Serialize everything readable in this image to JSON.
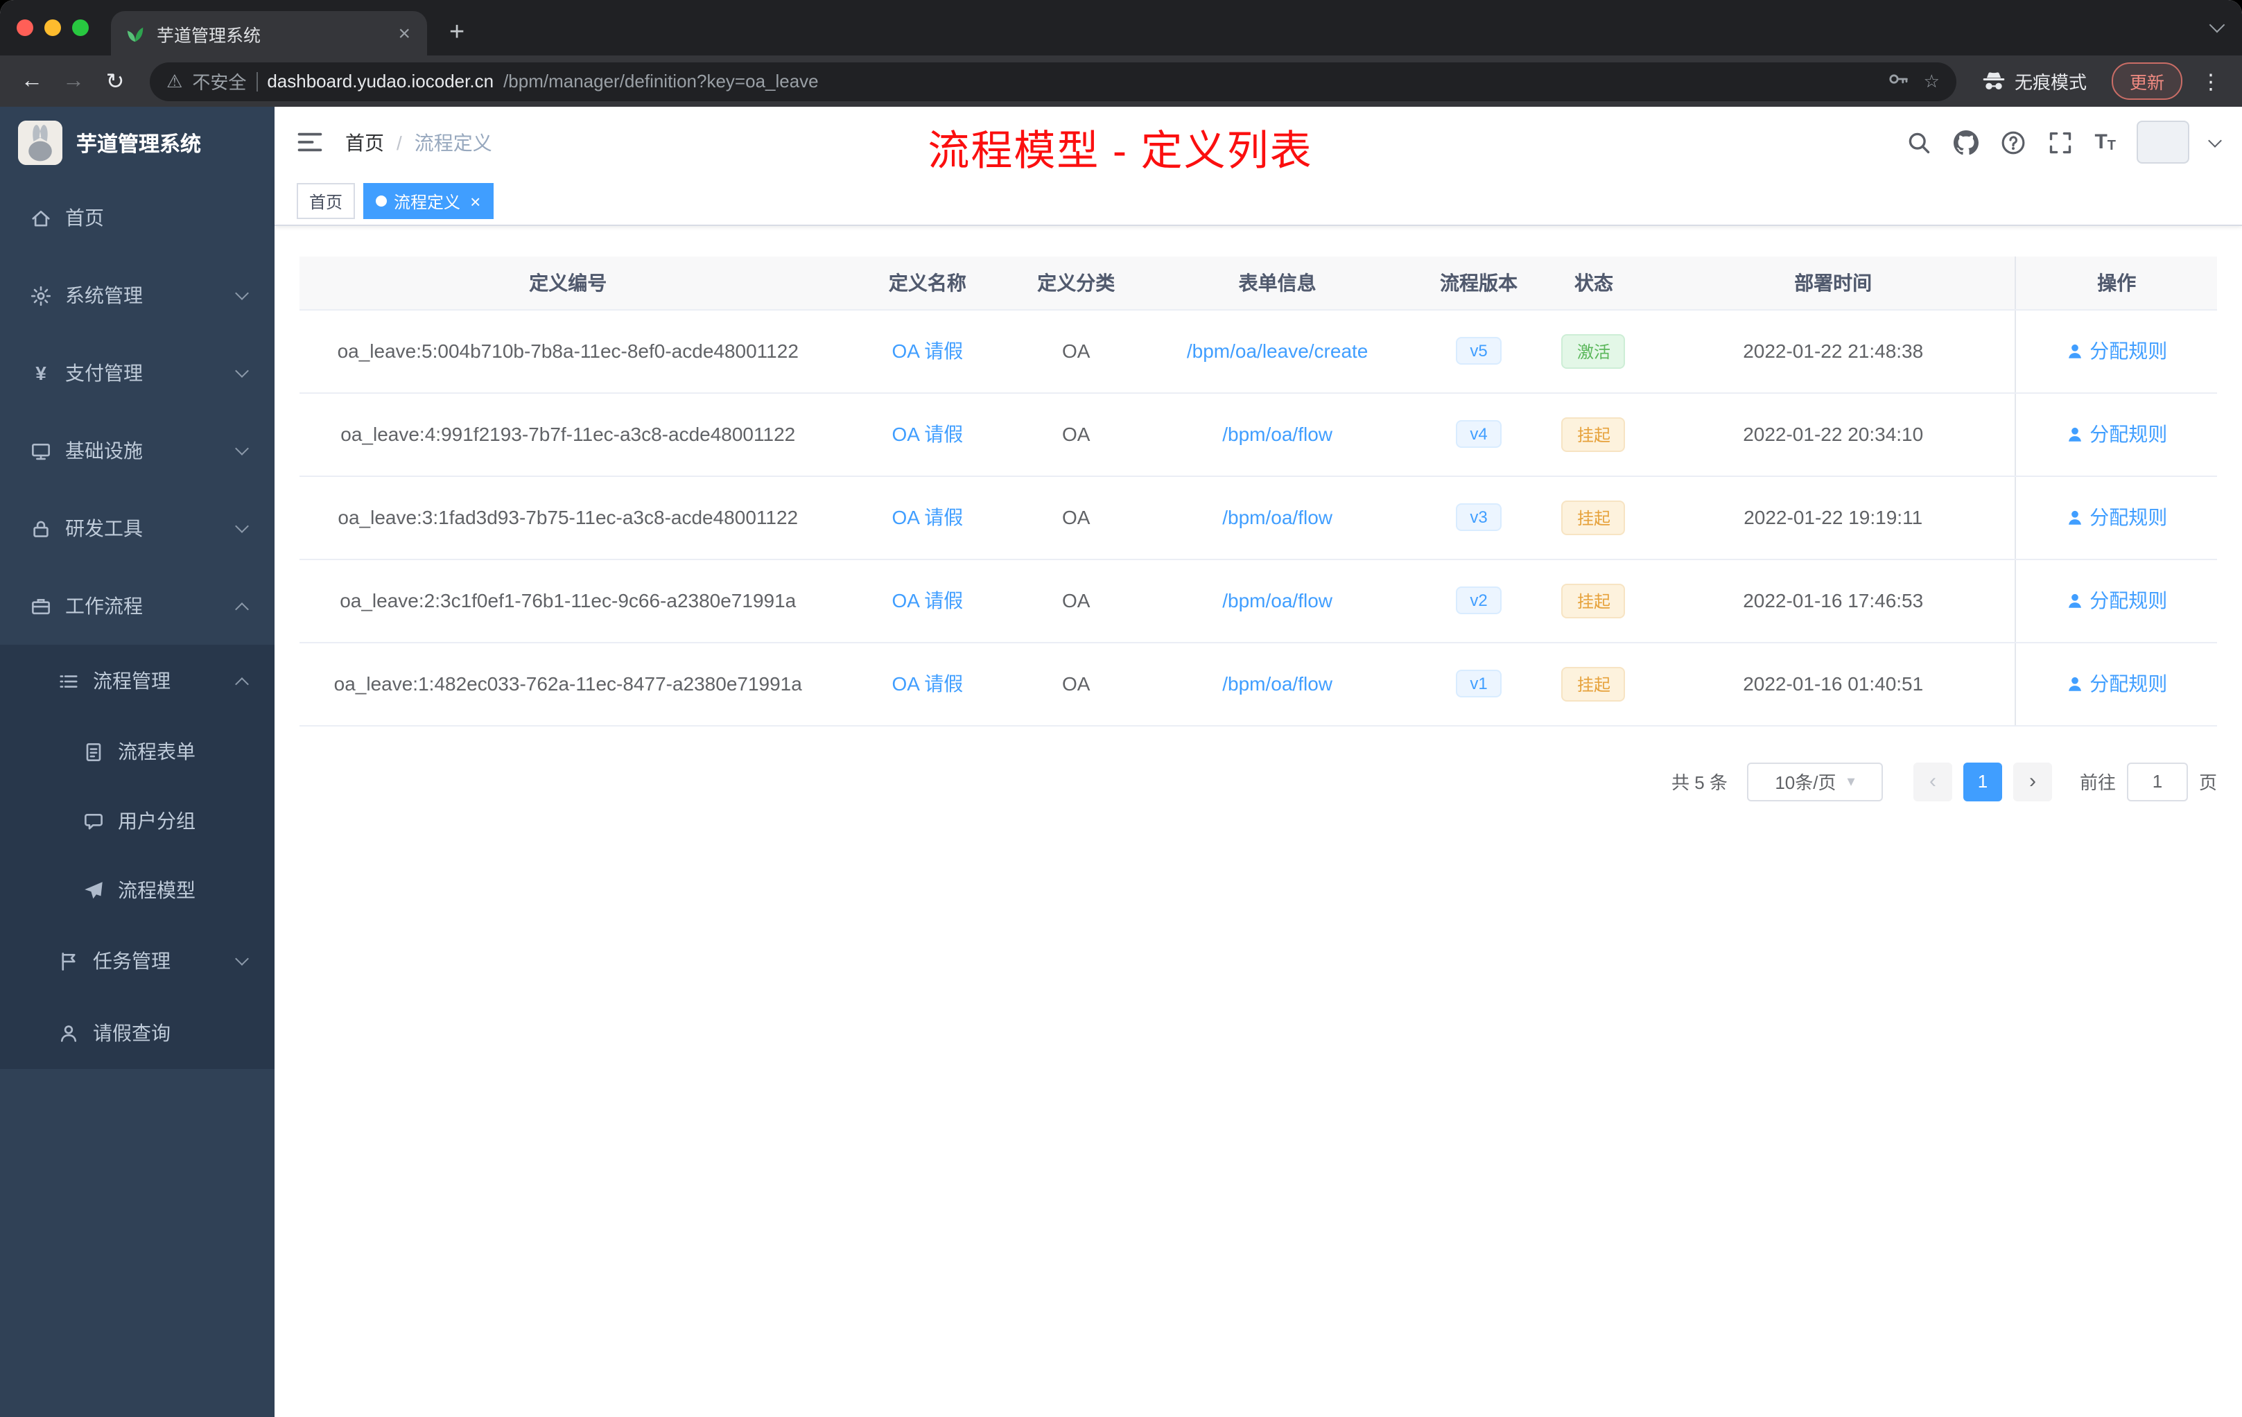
{
  "colors": {
    "accent": "#409eff",
    "sidebar_bg": "#304156",
    "annotation_red": "#fb0f0f",
    "success": "#67c23a",
    "warning": "#e6a23c"
  },
  "glyphs": {
    "close": "×",
    "plus": "+",
    "dots": "⋮",
    "star": "☆",
    "warning": "⚠",
    "back": "←",
    "forward": "→",
    "reload": "↻",
    "prev": "‹",
    "next": "›",
    "caret": "▾",
    "sep": "/"
  },
  "browser": {
    "tab": {
      "title": "芋道管理系统"
    },
    "toolbar": {
      "security_label": "不安全",
      "url_host": "dashboard.yudao.iocoder.cn",
      "url_path": "/bpm/manager/definition?key=oa_leave",
      "incognito_label": "无痕模式",
      "update_label": "更新"
    }
  },
  "sidebar": {
    "logo_title": "芋道管理系统",
    "items": [
      {
        "label": "首页",
        "icon": "home-icon",
        "level": 1
      },
      {
        "label": "系统管理",
        "icon": "gear-icon",
        "level": 1,
        "chevron": "down"
      },
      {
        "label": "支付管理",
        "icon": "yen-icon",
        "level": 1,
        "chevron": "down"
      },
      {
        "label": "基础设施",
        "icon": "monitor-icon",
        "level": 1,
        "chevron": "down"
      },
      {
        "label": "研发工具",
        "icon": "lock-icon",
        "level": 1,
        "chevron": "down"
      },
      {
        "label": "工作流程",
        "icon": "briefcase-icon",
        "level": 1,
        "chevron": "up"
      },
      {
        "label": "流程管理",
        "icon": "list-icon",
        "level": 2,
        "chevron": "up"
      },
      {
        "label": "流程表单",
        "icon": "form-icon",
        "level": 3
      },
      {
        "label": "用户分组",
        "icon": "chat-icon",
        "level": 3
      },
      {
        "label": "流程模型",
        "icon": "send-icon",
        "level": 3
      },
      {
        "label": "任务管理",
        "icon": "flag-icon",
        "level": 2,
        "chevron": "down"
      },
      {
        "label": "请假查询",
        "icon": "user-icon",
        "level": 2
      }
    ]
  },
  "navbar": {
    "breadcrumb_home": "首页",
    "breadcrumb_current": "流程定义",
    "annotation": "流程模型 - 定义列表"
  },
  "tags": {
    "home": "首页",
    "active": "流程定义"
  },
  "table": {
    "headers": [
      "定义编号",
      "定义名称",
      "定义分类",
      "表单信息",
      "流程版本",
      "状态",
      "部署时间",
      "操作"
    ],
    "rows": [
      {
        "id": "oa_leave:5:004b710b-7b8a-11ec-8ef0-acde48001122",
        "name": "OA 请假",
        "category": "OA",
        "form": "/bpm/oa/leave/create",
        "version": "v5",
        "status": "激活",
        "status_type": "success",
        "deploy_time": "2022-01-22 21:48:38",
        "action": "分配规则"
      },
      {
        "id": "oa_leave:4:991f2193-7b7f-11ec-a3c8-acde48001122",
        "name": "OA 请假",
        "category": "OA",
        "form": "/bpm/oa/flow",
        "version": "v4",
        "status": "挂起",
        "status_type": "warning",
        "deploy_time": "2022-01-22 20:34:10",
        "action": "分配规则"
      },
      {
        "id": "oa_leave:3:1fad3d93-7b75-11ec-a3c8-acde48001122",
        "name": "OA 请假",
        "category": "OA",
        "form": "/bpm/oa/flow",
        "version": "v3",
        "status": "挂起",
        "status_type": "warning",
        "deploy_time": "2022-01-22 19:19:11",
        "action": "分配规则"
      },
      {
        "id": "oa_leave:2:3c1f0ef1-76b1-11ec-9c66-a2380e71991a",
        "name": "OA 请假",
        "category": "OA",
        "form": "/bpm/oa/flow",
        "version": "v2",
        "status": "挂起",
        "status_type": "warning",
        "deploy_time": "2022-01-16 17:46:53",
        "action": "分配规则"
      },
      {
        "id": "oa_leave:1:482ec033-762a-11ec-8477-a2380e71991a",
        "name": "OA 请假",
        "category": "OA",
        "form": "/bpm/oa/flow",
        "version": "v1",
        "status": "挂起",
        "status_type": "warning",
        "deploy_time": "2022-01-16 01:40:51",
        "action": "分配规则"
      }
    ]
  },
  "pagination": {
    "total_label": "共 5 条",
    "page_size": "10条/页",
    "current_page": "1",
    "goto_label": "前往",
    "goto_value": "1",
    "page_unit": "页"
  }
}
